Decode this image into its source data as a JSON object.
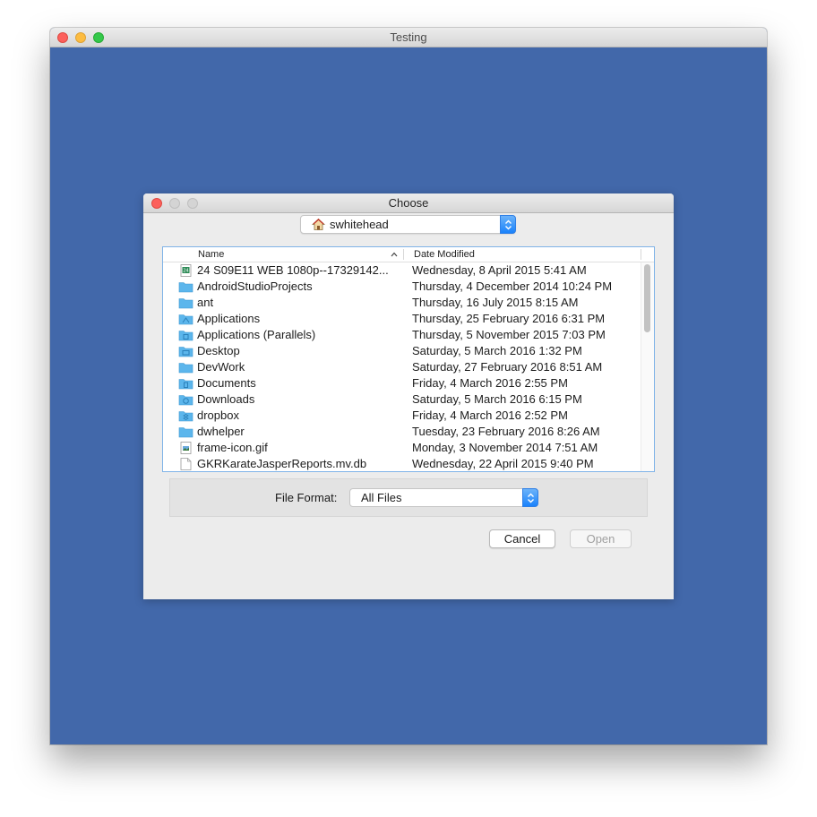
{
  "window": {
    "title": "Testing"
  },
  "dialog": {
    "title": "Choose",
    "location": "swhitehead",
    "list_header": {
      "name": "Name",
      "date_modified": "Date Modified"
    },
    "files": [
      {
        "icon": "video-file-icon",
        "name": "24 S09E11 WEB 1080p--17329142...",
        "date": "Wednesday, 8 April 2015 5:41 AM"
      },
      {
        "icon": "folder-icon",
        "name": "AndroidStudioProjects",
        "date": "Thursday, 4 December 2014 10:24 PM"
      },
      {
        "icon": "folder-icon",
        "name": "ant",
        "date": "Thursday, 16 July 2015 8:15 AM"
      },
      {
        "icon": "applications-folder-icon",
        "name": "Applications",
        "date": "Thursday, 25 February 2016 6:31 PM"
      },
      {
        "icon": "parallels-folder-icon",
        "name": "Applications (Parallels)",
        "date": "Thursday, 5 November 2015 7:03 PM"
      },
      {
        "icon": "desktop-folder-icon",
        "name": "Desktop",
        "date": "Saturday, 5 March 2016 1:32 PM"
      },
      {
        "icon": "folder-icon",
        "name": "DevWork",
        "date": "Saturday, 27 February 2016 8:51 AM"
      },
      {
        "icon": "documents-folder-icon",
        "name": "Documents",
        "date": "Friday, 4 March 2016 2:55 PM"
      },
      {
        "icon": "downloads-folder-icon",
        "name": "Downloads",
        "date": "Saturday, 5 March 2016 6:15 PM"
      },
      {
        "icon": "dropbox-folder-icon",
        "name": "dropbox",
        "date": "Friday, 4 March 2016 2:52 PM"
      },
      {
        "icon": "folder-icon",
        "name": "dwhelper",
        "date": "Tuesday, 23 February 2016 8:26 AM"
      },
      {
        "icon": "image-file-icon",
        "name": "frame-icon.gif",
        "date": "Monday, 3 November 2014 7:51 AM"
      },
      {
        "icon": "document-file-icon",
        "name": "GKRKarateJasperReports.mv.db",
        "date": "Wednesday, 22 April 2015 9:40 PM"
      }
    ],
    "file_format": {
      "label": "File Format:",
      "selected": "All Files"
    },
    "buttons": {
      "cancel": "Cancel",
      "open": "Open"
    }
  },
  "colors": {
    "desktop_background": "#4268aa",
    "accent_blue": "#1a82fb",
    "folder_blue": "#5cb6ec",
    "list_border": "#7fb3e8"
  }
}
